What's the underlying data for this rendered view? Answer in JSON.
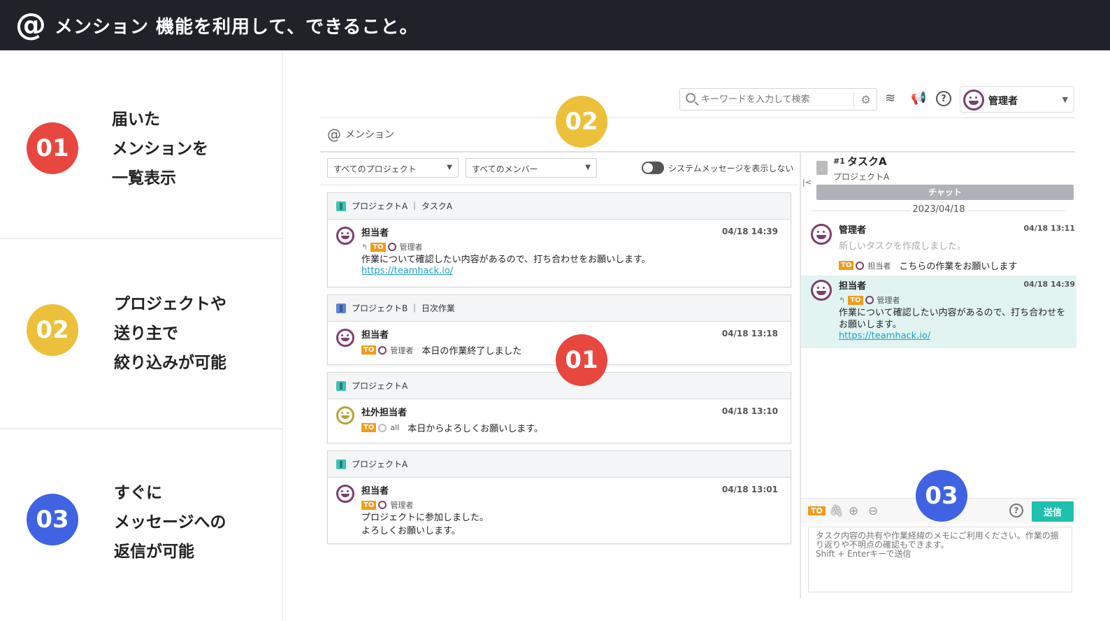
{
  "header": {
    "icon": "at-sign-icon",
    "title": "メンション 機能を利用して、できること。"
  },
  "features": [
    {
      "num": "01",
      "color": "#e8473f",
      "lines": [
        "届いた",
        "メンションを",
        "一覧表示"
      ]
    },
    {
      "num": "02",
      "color": "#ecc03a",
      "lines": [
        "プロジェクトや",
        "送り主で",
        "絞り込みが可能"
      ]
    },
    {
      "num": "03",
      "color": "#3f63e2",
      "lines": [
        "すぐに",
        "メッセージへの",
        "返信が可能"
      ]
    }
  ],
  "app": {
    "search_placeholder": "キーワードを入力して検索",
    "user_name": "管理者",
    "page_title": "メンション",
    "filter_project": "すべてのプロジェクト",
    "filter_member": "すべてのメンバー",
    "toggle_label": "システムメッセージを表示しない",
    "to_label": "TO",
    "cards": [
      {
        "header": "プロジェクトA ｜ タスクA",
        "project_color": "#3cc3b4",
        "sender": "担当者",
        "time": "04/18 14:39",
        "to": "管理者",
        "message": "作業について確認したい内容があるので、打ち合わせをお願いします。",
        "link": "https://teamhack.io/"
      },
      {
        "header": "プロジェクトB ｜ 日次作業",
        "project_color": "#5b86d6",
        "sender": "担当者",
        "time": "04/18 13:18",
        "to": "管理者",
        "message": "本日の作業終了しました"
      },
      {
        "header": "プロジェクトA",
        "project_color": "#3cc3b4",
        "sender": "社外担当者",
        "time": "04/18 13:10",
        "to": "all",
        "message": "本日からよろしくお願いします。"
      },
      {
        "header": "プロジェクトA",
        "project_color": "#3cc3b4",
        "sender": "担当者",
        "time": "04/18 13:01",
        "to": "管理者",
        "message_line1": "プロジェクトに参加しました。",
        "message_line2": "よろしくお願いします。"
      }
    ],
    "detail": {
      "task_no": "#1",
      "task_title": "タスクA",
      "project": "プロジェクトA",
      "chat_tab": "チャット",
      "date": "2023/04/18",
      "messages": [
        {
          "sender": "管理者",
          "time": "04/18 13:11",
          "system": "新しいタスクを作成しました。",
          "to": "担当者",
          "text": "こちらの作業をお願いします"
        },
        {
          "sender": "担当者",
          "time": "04/18 14:39",
          "to": "管理者",
          "text": "作業について確認したい内容があるので、打ち合わせをお願いします。",
          "link": "https://teamhack.io/"
        }
      ],
      "send_label": "送信",
      "composer_placeholder": "タスク内容の共有や作業経緯のメモにご利用ください。作業の振り返りや不明点の確認もできます。\nShift + Enterキーで送信"
    }
  },
  "overlays": [
    {
      "num": "02",
      "color": "#ecc03a"
    },
    {
      "num": "01",
      "color": "#e8473f"
    },
    {
      "num": "03",
      "color": "#3f63e2"
    }
  ]
}
